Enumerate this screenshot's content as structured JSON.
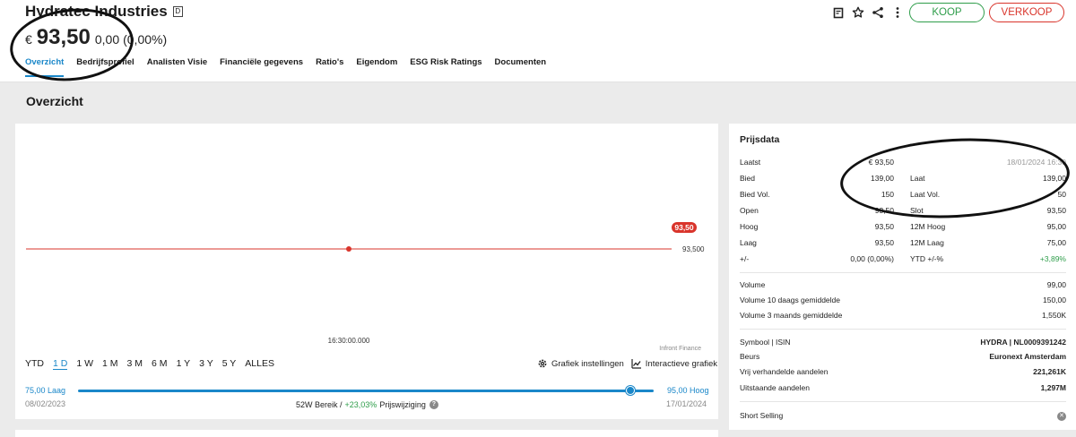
{
  "header": {
    "title": "Hydratec Industries",
    "badge": "D",
    "currency": "€",
    "price": "93,50",
    "change": "0,00",
    "change_pct": "(0,00%)",
    "buy_label": "KOOP",
    "sell_label": "VERKOOP"
  },
  "tabs": [
    {
      "label": "Overzicht"
    },
    {
      "label": "Bedrijfsprofiel"
    },
    {
      "label": "Analisten Visie"
    },
    {
      "label": "Financiële gegevens"
    },
    {
      "label": "Ratio's"
    },
    {
      "label": "Eigendom"
    },
    {
      "label": "ESG Risk Ratings"
    },
    {
      "label": "Documenten"
    }
  ],
  "section_title": "Overzicht",
  "chart": {
    "price_badge": "93,50",
    "axis_value": "93,500",
    "time_label": "16:30:00.000",
    "source": "Infront Finance",
    "line_color": "#d9342b",
    "accent": "#1a87c9"
  },
  "ranges": [
    "YTD",
    "1 D",
    "1 W",
    "1 M",
    "3 M",
    "6 M",
    "1 Y",
    "3 Y",
    "5 Y",
    "ALLES"
  ],
  "chart_tools": {
    "settings_label": "Grafiek instellingen",
    "interactive_label": "Interactieve grafiek"
  },
  "range_bar": {
    "low_label": "75,00 Laag",
    "high_label": "95,00 Hoog",
    "low_date": "08/02/2023",
    "high_date": "17/01/2024",
    "summary_prefix": "52W Bereik  /",
    "summary_pct": "+23,03%",
    "summary_suffix": "Prijswijziging",
    "position_pct": 96
  },
  "prijsdata": {
    "title": "Prijsdata",
    "rows": [
      {
        "l1": "Laatst",
        "v1": "€ 93,50",
        "l2": "",
        "v2": "18/01/2024 16:30"
      },
      {
        "l1": "Bied",
        "v1": "139,00",
        "l2": "Laat",
        "v2": "139,00"
      },
      {
        "l1": "Bied Vol.",
        "v1": "150",
        "l2": "Laat Vol.",
        "v2": "50"
      },
      {
        "l1": "Open",
        "v1": "93,50",
        "l2": "Slot",
        "v2": "93,50"
      },
      {
        "l1": "Hoog",
        "v1": "93,50",
        "l2": "12M Hoog",
        "v2": "95,00"
      },
      {
        "l1": "Laag",
        "v1": "93,50",
        "l2": "12M Laag",
        "v2": "75,00"
      },
      {
        "l1": "+/-",
        "v1": "0,00 (0,00%)",
        "l2": "YTD +/-%",
        "v2": "+3,89%"
      }
    ],
    "volume": [
      {
        "label": "Volume",
        "value": "99,00"
      },
      {
        "label": "Volume 10 daags gemiddelde",
        "value": "150,00"
      },
      {
        "label": "Volume 3 maands gemiddelde",
        "value": "1,550K"
      }
    ],
    "info": [
      {
        "label": "Symbool | ISIN",
        "value": "HYDRA | NL0009391242"
      },
      {
        "label": "Beurs",
        "value": "Euronext Amsterdam"
      },
      {
        "label": "Vrij verhandelde aandelen",
        "value": "221,261K"
      },
      {
        "label": "Uitstaande aandelen",
        "value": "1,297M"
      }
    ],
    "short_selling": "Short Selling"
  }
}
